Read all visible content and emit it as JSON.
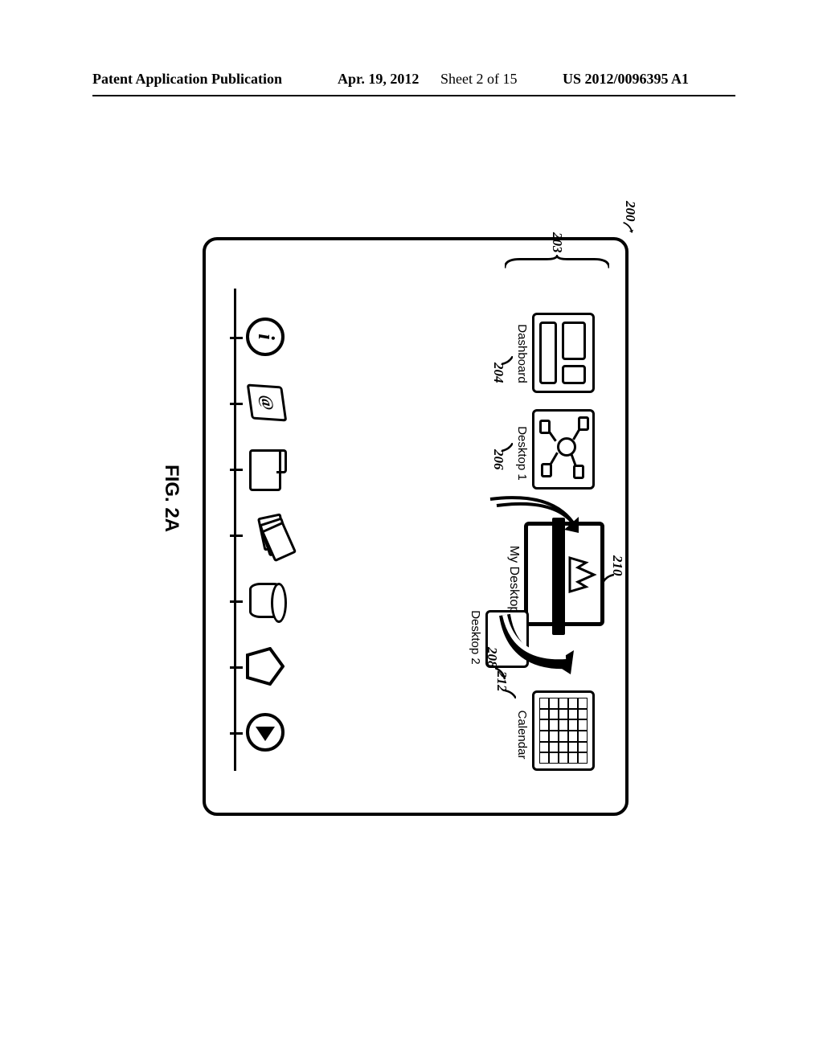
{
  "header": {
    "pub": "Patent Application Publication",
    "date": "Apr. 19, 2012",
    "sheet": "Sheet 2 of 15",
    "docnum": "US 2012/0096395 A1"
  },
  "figure": {
    "label": "FIG. 2A",
    "ref_screen": "200",
    "ref_thumbrow": "203",
    "thumbnails": {
      "dashboard": {
        "label": "Dashboard",
        "ref": "204"
      },
      "desktop1": {
        "label": "Desktop 1",
        "ref": "206"
      },
      "mydesktop": {
        "label": "My Desktop",
        "ref": "210"
      },
      "desktop2": {
        "label": "Desktop 2",
        "ref": "208"
      },
      "calendar": {
        "label": "Calendar",
        "ref": "212"
      }
    },
    "dock_icons": [
      "info-icon",
      "at-icon",
      "folder-icon",
      "stack-icon",
      "cylinder-icon",
      "pentagon-icon",
      "play-icon"
    ]
  }
}
